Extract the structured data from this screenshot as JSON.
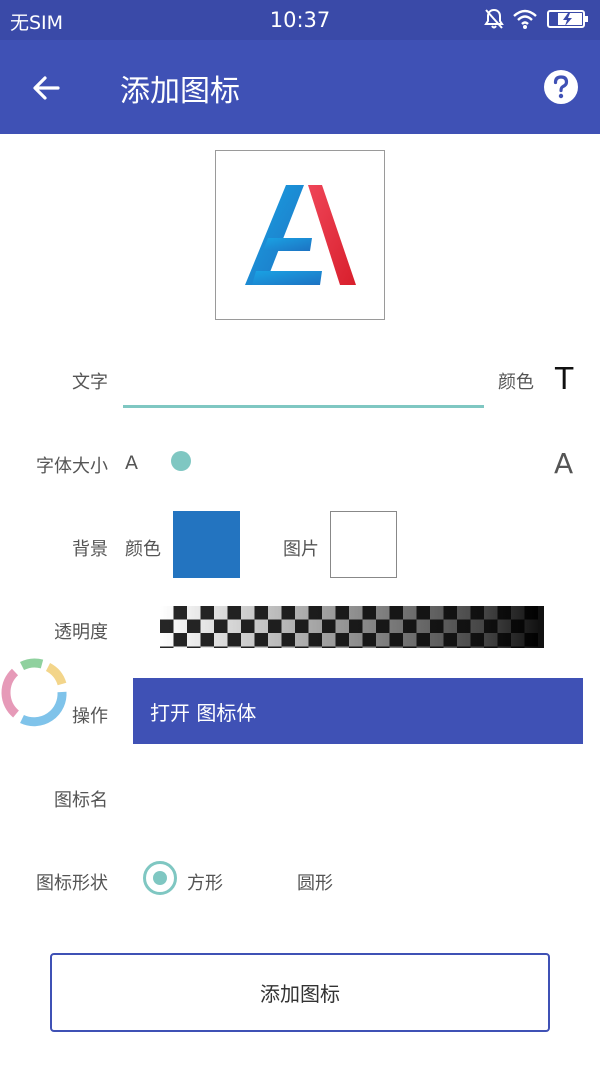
{
  "status_bar": {
    "carrier": "无SIM",
    "time": "10:37",
    "icons": [
      "mute-bell-icon",
      "wifi-icon",
      "battery-charging-icon"
    ]
  },
  "app_bar": {
    "title": "添加图标",
    "back_icon": "arrow-left-icon",
    "help_icon": "help-circle-icon"
  },
  "preview": {
    "icon": "letter-a-logo",
    "colors": {
      "blue": "#1e88d6",
      "red": "#e8303f"
    }
  },
  "form": {
    "text": {
      "label": "文字",
      "value": "",
      "color_label": "颜色",
      "color_icon": "T"
    },
    "font_size": {
      "label": "字体大小",
      "small_label": "A",
      "large_label": "A"
    },
    "background": {
      "label": "背景",
      "color_label": "颜色",
      "color_value": "#2374c0",
      "image_label": "图片"
    },
    "opacity": {
      "label": "透明度"
    },
    "action": {
      "label": "操作",
      "button_label": "打开 图标体"
    },
    "icon_name": {
      "label": "图标名"
    },
    "icon_shape": {
      "label": "图标形状",
      "options": [
        {
          "label": "方形",
          "selected": true
        },
        {
          "label": "圆形",
          "selected": false
        }
      ]
    }
  },
  "submit_label": "添加图标",
  "accent_colors": {
    "primary": "#3f51b5",
    "accent": "#7fc7c2"
  }
}
